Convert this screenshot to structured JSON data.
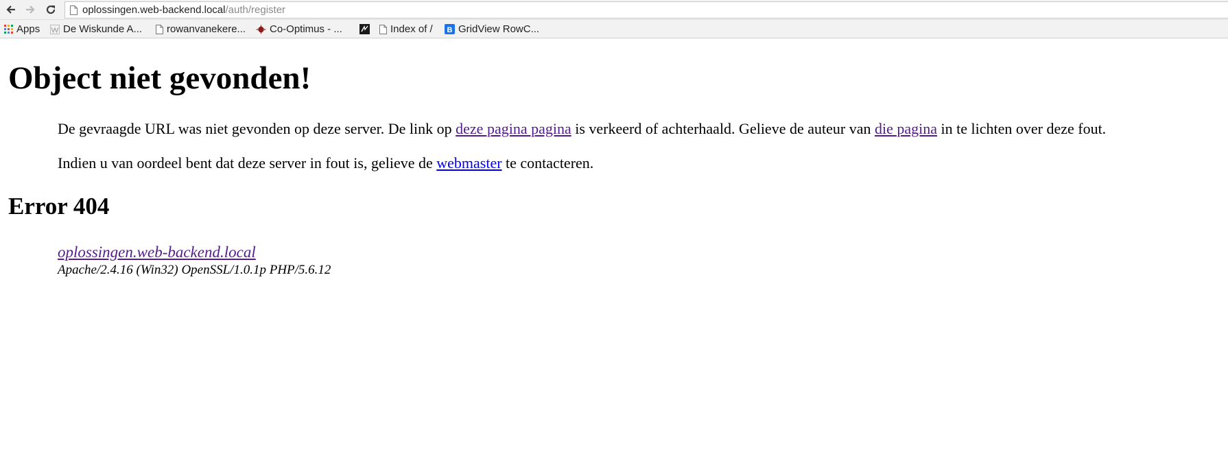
{
  "browser": {
    "address_bar": {
      "host": "oplossingen.web-backend.local",
      "path": "/auth/register"
    },
    "bookmarks": [
      {
        "label": "Apps",
        "icon": "apps-grid-icon"
      },
      {
        "label": "De Wiskunde A...",
        "icon": "wiskunde-site-icon"
      },
      {
        "label": "rowanvanekere...",
        "icon": "page-icon"
      },
      {
        "label": "Co-Optimus - ...",
        "icon": "co-optimus-icon"
      },
      {
        "label": "",
        "icon": "dark-site-icon"
      },
      {
        "label": "Index of /",
        "icon": "page-icon"
      },
      {
        "label": "GridView RowC...",
        "icon": "blogger-b-icon"
      }
    ]
  },
  "page": {
    "title": "Object niet gevonden!",
    "paragraph1": {
      "text_before": "De gevraagde URL was niet gevonden op deze server. De link op ",
      "link1": "deze pagina pagina",
      "text_middle": " is verkeerd of achterhaald. Gelieve de auteur van ",
      "link2": "die pagina",
      "text_after": " in te lichten over deze fout."
    },
    "paragraph2": {
      "text_before": "Indien u van oordeel bent dat deze server in fout is, gelieve de ",
      "link": "webmaster",
      "text_after": " te contacteren."
    },
    "error_heading": "Error 404",
    "address": {
      "host_link": "oplossingen.web-backend.local",
      "server_signature": "Apache/2.4.16 (Win32) OpenSSL/1.0.1p PHP/5.6.12"
    }
  }
}
